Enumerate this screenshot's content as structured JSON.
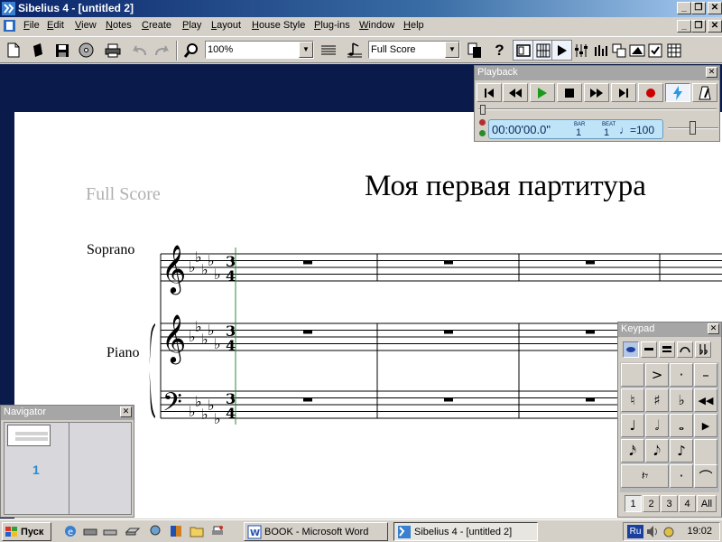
{
  "window": {
    "title": "Sibelius 4 - [untitled 2]",
    "caption_buttons": [
      "_",
      "❐",
      "✕"
    ],
    "doc_buttons": [
      "_",
      "❐",
      "✕"
    ]
  },
  "menu": {
    "items": [
      "File",
      "Edit",
      "View",
      "Notes",
      "Create",
      "Play",
      "Layout",
      "House Style",
      "Plug-ins",
      "Window",
      "Help"
    ]
  },
  "toolbar": {
    "zoom_value": "100%",
    "part_value": "Full Score",
    "help_label": "?"
  },
  "score": {
    "part_name": "Full Score",
    "title": "Моя первая партитура",
    "instruments": [
      "Soprano",
      "Piano"
    ],
    "time_signature": {
      "top": "3",
      "bottom": "4"
    }
  },
  "playback": {
    "title": "Playback",
    "close": "✕",
    "time": "00:00'00.0\"",
    "bar_label": "BAR",
    "bar_value": "1",
    "beat_label": "BEAT",
    "beat_value": "1",
    "tempo": "♩=100"
  },
  "keypad": {
    "title": "Keypad",
    "close": "✕",
    "keys": [
      "",
      ">",
      "·",
      "–",
      "♮",
      "♯",
      "♭",
      "◀◀",
      "♩",
      "𝅗𝅥",
      "𝅝",
      "▶",
      "𝅘𝅥𝅯",
      "𝅘𝅥𝅮",
      "♪",
      "",
      "𝄽𝄾",
      "",
      "·",
      "⌒"
    ],
    "layouts": [
      "1",
      "2",
      "3",
      "4",
      "All"
    ]
  },
  "navigator": {
    "title": "Navigator",
    "close": "✕",
    "page_number": "1"
  },
  "taskbar": {
    "start_label": "Пуск",
    "tasks": [
      "BOOK - Microsoft Word",
      "Sibelius 4 - [untitled 2]"
    ],
    "lang": "Ru",
    "clock": "19:02"
  },
  "colors": {
    "titlebar": "#0a246a",
    "workspace": "#0a1a4a",
    "palette_title": "#a6a6a6",
    "lcd": "#bfe3f7",
    "record": "#cc0000",
    "play": "#1a9a1a",
    "nav_number": "#2a8ad0"
  }
}
